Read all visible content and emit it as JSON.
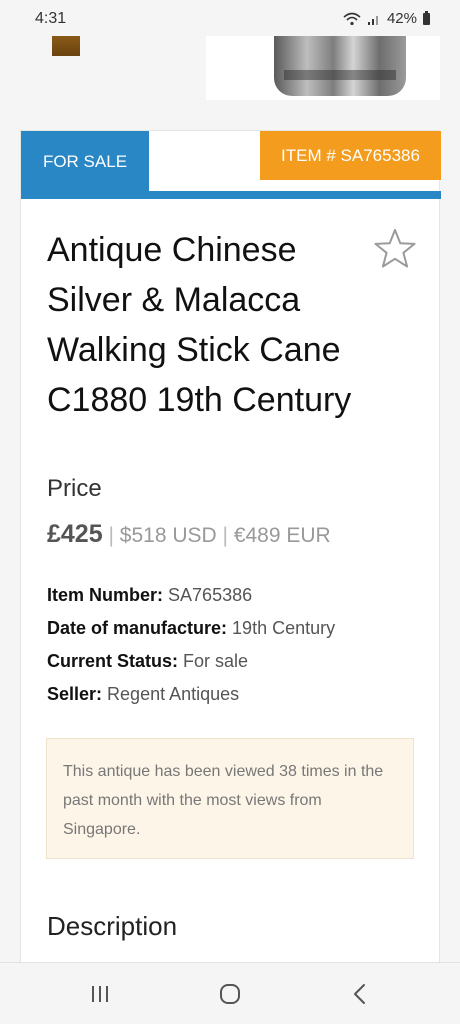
{
  "status": {
    "time": "4:31",
    "battery": "42%"
  },
  "listing": {
    "tab_label": "FOR SALE",
    "item_badge": "ITEM # SA765386",
    "title": "Antique Chinese Silver & Malacca Walking Stick Cane C1880 19th Century",
    "price_label": "Price",
    "price_gbp": "£425",
    "separator": "|",
    "price_usd": "$518 USD",
    "price_eur": "€489 EUR",
    "specs": [
      {
        "label": "Item Number:",
        "value": "SA765386"
      },
      {
        "label": "Date of manufacture:",
        "value": "19th Century"
      },
      {
        "label": "Current Status:",
        "value": "For sale"
      },
      {
        "label": "Seller:",
        "value": "Regent Antiques"
      }
    ],
    "views_note": "This antique has been viewed 38 times in the past month with the most views from Singapore.",
    "description_heading": "Description"
  },
  "colors": {
    "tab_blue": "#2a87c5",
    "badge_orange": "#f39c1e",
    "note_bg": "#fef5e9"
  },
  "icons": [
    "wifi-icon",
    "signal-icon",
    "battery-icon",
    "favorite-star-icon",
    "recent-apps-icon",
    "home-icon",
    "back-icon"
  ]
}
